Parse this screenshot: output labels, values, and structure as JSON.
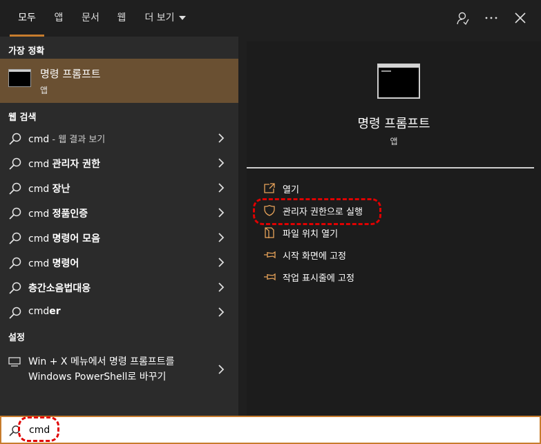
{
  "topbar": {
    "tabs": [
      {
        "label": "모두"
      },
      {
        "label": "앱"
      },
      {
        "label": "문서"
      },
      {
        "label": "웹"
      },
      {
        "label": "더 보기"
      }
    ],
    "active_tab": "모두",
    "icons": [
      "feedback-icon",
      "more-icon",
      "close-icon"
    ]
  },
  "left": {
    "best_match_title": "가장 정확",
    "best_match": {
      "name": "명령 프롬프트",
      "type": "앱"
    },
    "web_title": "웹 검색",
    "web_items": [
      {
        "prefix": "cmd",
        "rest": " - 웹 결과 보기"
      },
      {
        "prefix": "cmd ",
        "rest": "관리자 권한"
      },
      {
        "prefix": "cmd ",
        "rest": "장난"
      },
      {
        "prefix": "cmd ",
        "rest": "정품인증"
      },
      {
        "prefix": "cmd ",
        "rest": "명령어 모음"
      },
      {
        "prefix": "cmd ",
        "rest": "명령어"
      },
      {
        "prefix": "",
        "rest": "층간소음법대응"
      },
      {
        "prefix": "cmd",
        "rest": "er"
      }
    ],
    "settings_title": "설정",
    "settings_item": {
      "line1": "Win + X 메뉴에서 명령 프롬프트를",
      "line2": "Windows PowerShell로 바꾸기"
    }
  },
  "detail": {
    "title": "명령 프롬프트",
    "subtitle": "앱",
    "actions": [
      {
        "label": "열기",
        "icon": "open-icon"
      },
      {
        "label": "관리자 권한으로 실행",
        "icon": "shield-icon"
      },
      {
        "label": "파일 위치 열기",
        "icon": "file-location-icon"
      },
      {
        "label": "시작 화면에 고정",
        "icon": "pin-icon"
      },
      {
        "label": "작업 표시줄에 고정",
        "icon": "pin-icon"
      }
    ]
  },
  "search": {
    "value": "cmd"
  },
  "colors": {
    "accent": "#c77c2d",
    "selected": "#6a5032",
    "annotation": "#e00000"
  }
}
